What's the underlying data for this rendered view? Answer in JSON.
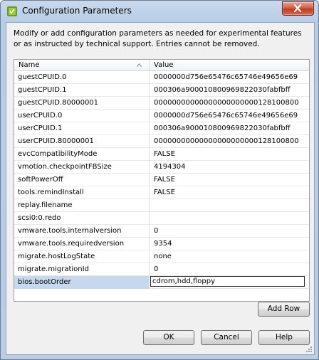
{
  "window": {
    "title": "Configuration Parameters",
    "icon": "vsphere-config-icon",
    "close_icon": "close-icon"
  },
  "description": "Modify or add configuration parameters as needed for experimental features or as instructed by technical support. Entries cannot be removed.",
  "table": {
    "columns": [
      "Name",
      "Value"
    ],
    "rows": [
      {
        "name": "guestCPUID.0",
        "value": "0000000d756e65476c65746e49656e69"
      },
      {
        "name": "guestCPUID.1",
        "value": "000306a900010800969822030fabfbff"
      },
      {
        "name": "guestCPUID.80000001",
        "value": "00000000000000000000000128100800"
      },
      {
        "name": "userCPUID.0",
        "value": "0000000d756e65476c65746e49656e69"
      },
      {
        "name": "userCPUID.1",
        "value": "000306a900010800969822030fabfbff"
      },
      {
        "name": "userCPUID.80000001",
        "value": "00000000000000000000000128100800"
      },
      {
        "name": "evcCompatibilityMode",
        "value": "FALSE"
      },
      {
        "name": "vmotion.checkpointFBSize",
        "value": "4194304"
      },
      {
        "name": "softPowerOff",
        "value": "FALSE"
      },
      {
        "name": "tools.remindInstall",
        "value": "FALSE"
      },
      {
        "name": "replay.filename",
        "value": ""
      },
      {
        "name": "scsi0:0.redo",
        "value": ""
      },
      {
        "name": "vmware.tools.internalversion",
        "value": "0"
      },
      {
        "name": "vmware.tools.requiredversion",
        "value": "9354"
      },
      {
        "name": "migrate.hostLogState",
        "value": "none"
      },
      {
        "name": "migrate.migrationId",
        "value": "0"
      },
      {
        "name": "bios.bootOrder",
        "value": "cdrom,hdd,floppy"
      }
    ]
  },
  "buttons": {
    "add_row": "Add Row",
    "ok": "OK",
    "cancel": "Cancel",
    "help": "Help"
  }
}
